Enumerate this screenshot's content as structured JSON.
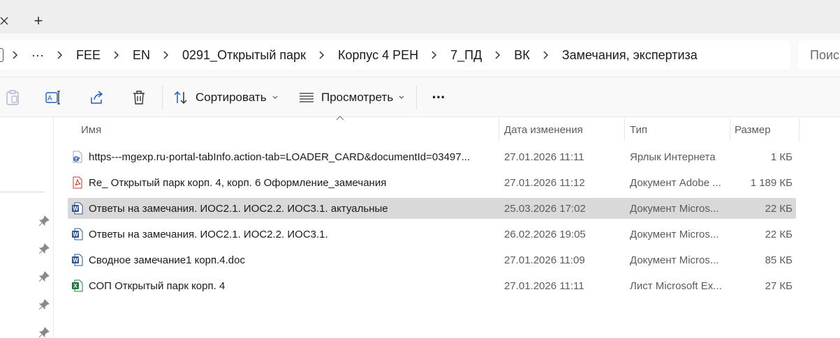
{
  "tabbar": {
    "new_tab": "+"
  },
  "breadcrumb": {
    "overflow": "···",
    "items": [
      "FEE",
      "EN",
      "0291_Открытый парк",
      "Корпус 4 РЕН",
      "7_ПД",
      "ВК",
      "Замечания, экспертиза"
    ]
  },
  "search": {
    "placeholder": "Поиск"
  },
  "toolbar": {
    "sort_label": "Сортировать",
    "view_label": "Просмотреть",
    "more_label": "···"
  },
  "columns": {
    "name": "Имя",
    "date": "Дата изменения",
    "type": "Тип",
    "size": "Размер"
  },
  "files": [
    {
      "icon": "internet-shortcut-icon",
      "name": "https---mgexp.ru-portal-tabInfo.action-tab=LOADER_CARD&documentId=03497...",
      "date": "27.01.2026 11:11",
      "type": "Ярлык Интернета",
      "size": "1 КБ"
    },
    {
      "icon": "pdf-file-icon",
      "name": "Re_ Открытый парк корп. 4, корп. 6 Оформление_замечания",
      "date": "27.01.2026 11:12",
      "type": "Документ Adobe ...",
      "size": "1 189 КБ"
    },
    {
      "icon": "word-file-icon",
      "name": "Ответы на замечания. ИОС2.1. ИОС2.2. ИОС3.1. актуальные",
      "date": "25.03.2026 17:02",
      "type": "Документ Micros...",
      "size": "22 КБ",
      "selected": true
    },
    {
      "icon": "word-file-icon",
      "name": "Ответы на замечания. ИОС2.1. ИОС2.2. ИОС3.1.",
      "date": "26.02.2026 19:05",
      "type": "Документ Micros...",
      "size": "22 КБ"
    },
    {
      "icon": "word-file-icon",
      "name": "Сводное замечание1 корп.4.doc",
      "date": "27.01.2026 11:09",
      "type": "Документ Micros...",
      "size": "85 КБ"
    },
    {
      "icon": "excel-file-icon",
      "name": "СОП Открытый парк корп. 4",
      "date": "27.01.2026 11:11",
      "type": "Лист Microsoft Ex...",
      "size": "27 КБ"
    }
  ],
  "colors": {
    "selected_row": "#d9d9d9",
    "accent_blue": "#1f5fbf",
    "pdf_red": "#d32f2f",
    "excel_green": "#1d7a3e"
  }
}
